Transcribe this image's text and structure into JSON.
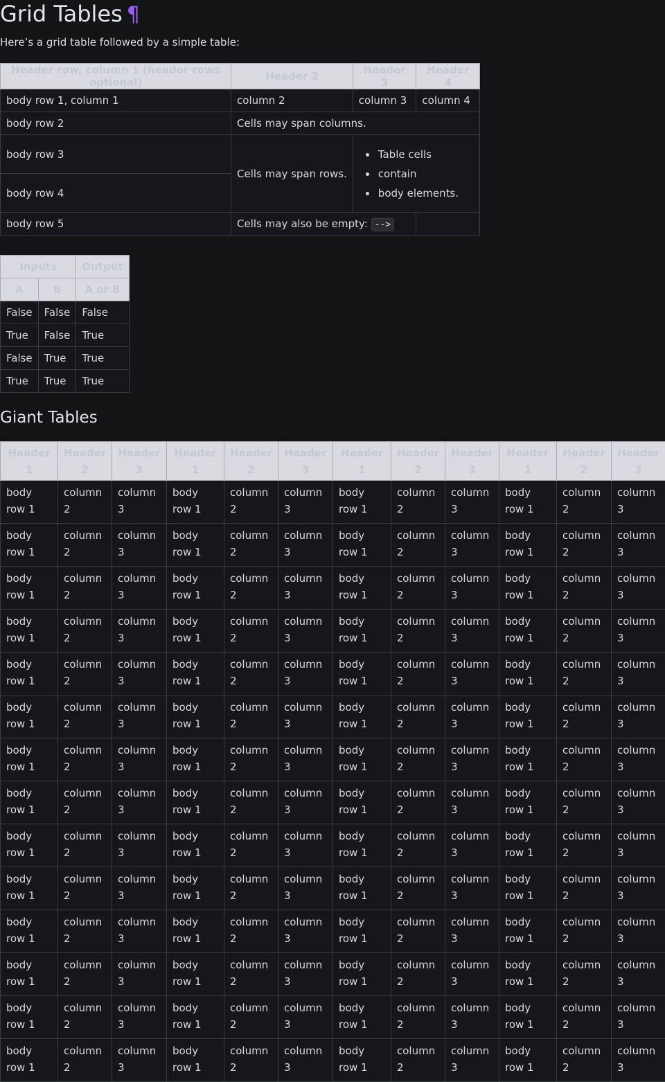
{
  "page": {
    "title": "Grid Tables",
    "pilcrow": "¶",
    "intro": "Here’s a grid table followed by a simple table:",
    "giant_heading": "Giant Tables"
  },
  "grid_table": {
    "headers": [
      "Header row, column 1 (header rows optional)",
      "Header 2",
      "Header 3",
      "Header 4"
    ],
    "row1": [
      "body row 1, column 1",
      "column 2",
      "column 3",
      "column 4"
    ],
    "row2": [
      "body row 2",
      "Cells may span columns."
    ],
    "row3": [
      "body row 3",
      "Cells may span rows."
    ],
    "bullets": [
      "Table cells",
      "contain",
      "body elements."
    ],
    "row4": [
      "body row 4"
    ],
    "row5": [
      "body row 5",
      "Cells may also be empty:",
      "-->"
    ]
  },
  "simple_table": {
    "group_headers": [
      "Inputs",
      "Output"
    ],
    "headers": [
      "A",
      "B",
      "A or B"
    ],
    "rows": [
      [
        "False",
        "False",
        "False"
      ],
      [
        "True",
        "False",
        "True"
      ],
      [
        "False",
        "True",
        "True"
      ],
      [
        "True",
        "True",
        "True"
      ]
    ]
  },
  "giant_table": {
    "headers": [
      "Header 1",
      "Header 2",
      "Header 3",
      "Header 1",
      "Header 2",
      "Header 3",
      "Header 1",
      "Header 2",
      "Header 3",
      "Header 1",
      "Header 2",
      "Header 3"
    ],
    "row_cells": [
      "body row 1",
      "column 2",
      "column 3",
      "body row 1",
      "column 2",
      "column 3",
      "body row 1",
      "column 2",
      "column 3",
      "body row 1",
      "column 2",
      "column 3"
    ],
    "row_count": 14
  }
}
